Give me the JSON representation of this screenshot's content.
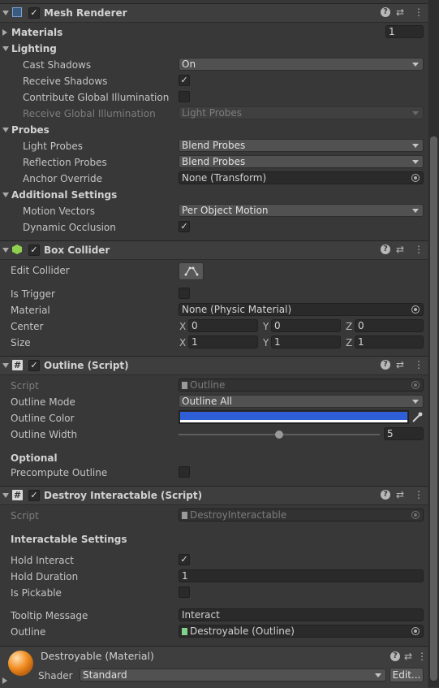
{
  "mesh_renderer": {
    "title": "Mesh Renderer",
    "materials_label": "Materials",
    "materials_count": "1",
    "lighting_label": "Lighting",
    "cast_shadows_label": "Cast Shadows",
    "cast_shadows_value": "On",
    "receive_shadows_label": "Receive Shadows",
    "contribute_gi_label": "Contribute Global Illumination",
    "receive_gi_label": "Receive Global Illumination",
    "receive_gi_value": "Light Probes",
    "probes_label": "Probes",
    "light_probes_label": "Light Probes",
    "light_probes_value": "Blend Probes",
    "reflection_probes_label": "Reflection Probes",
    "reflection_probes_value": "Blend Probes",
    "anchor_override_label": "Anchor Override",
    "anchor_override_value": "None (Transform)",
    "additional_settings_label": "Additional Settings",
    "motion_vectors_label": "Motion Vectors",
    "motion_vectors_value": "Per Object Motion",
    "dynamic_occlusion_label": "Dynamic Occlusion"
  },
  "box_collider": {
    "title": "Box Collider",
    "edit_collider_label": "Edit Collider",
    "is_trigger_label": "Is Trigger",
    "material_label": "Material",
    "material_value": "None (Physic Material)",
    "center_label": "Center",
    "center": {
      "x": "0",
      "y": "0",
      "z": "0"
    },
    "size_label": "Size",
    "size": {
      "x": "1",
      "y": "1",
      "z": "1"
    },
    "axis_x": "X",
    "axis_y": "Y",
    "axis_z": "Z"
  },
  "outline_script": {
    "title": "Outline (Script)",
    "script_label": "Script",
    "script_value": "Outline",
    "outline_mode_label": "Outline Mode",
    "outline_mode_value": "Outline All",
    "outline_color_label": "Outline Color",
    "outline_color": "#2f5fd6",
    "outline_width_label": "Outline Width",
    "outline_width_value": "5",
    "outline_width_fraction": 0.5,
    "optional_label": "Optional",
    "precompute_outline_label": "Precompute Outline"
  },
  "destroy_interactable": {
    "title": "Destroy Interactable (Script)",
    "script_label": "Script",
    "script_value": "DestroyInteractable",
    "interactable_settings_label": "Interactable Settings",
    "hold_interact_label": "Hold Interact",
    "hold_duration_label": "Hold Duration",
    "hold_duration_value": "1",
    "is_pickable_label": "Is Pickable",
    "tooltip_message_label": "Tooltip Message",
    "tooltip_message_value": "Interact",
    "outline_label": "Outline",
    "outline_value": "Destroyable (Outline)"
  },
  "material": {
    "title": "Destroyable (Material)",
    "shader_label": "Shader",
    "shader_value": "Standard",
    "edit_label": "Edit..."
  },
  "icons": {
    "help": "?",
    "presets": "⇄",
    "more": "⋮",
    "check": "✓",
    "hash": "#"
  },
  "colors": {
    "background": "#383838",
    "header": "#3e3e3e",
    "material_sphere": "#f08a1e"
  }
}
